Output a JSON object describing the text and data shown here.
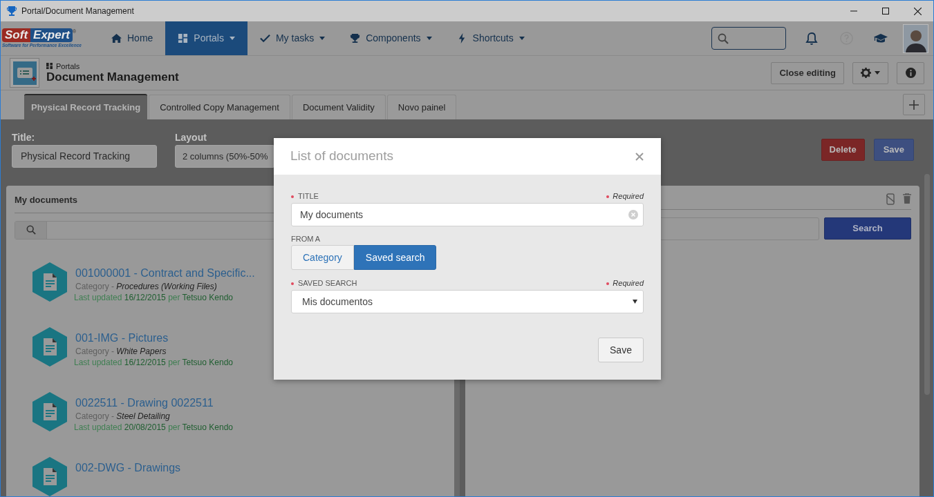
{
  "window": {
    "title": "Portal/Document Management"
  },
  "logo": {
    "part_1": "Soft",
    "part_2": "Expert",
    "mark": "®",
    "tagline": "Software for Performance Excellence"
  },
  "nav": {
    "items": [
      {
        "label": "Home",
        "kind": "home",
        "selected": false,
        "dropdown": false
      },
      {
        "label": "Portals",
        "kind": "grid",
        "selected": true,
        "dropdown": true
      },
      {
        "label": "My tasks",
        "kind": "check",
        "selected": false,
        "dropdown": true
      },
      {
        "label": "Components",
        "kind": "trophy",
        "selected": false,
        "dropdown": true
      },
      {
        "label": "Shortcuts",
        "kind": "bolt",
        "selected": false,
        "dropdown": true
      }
    ]
  },
  "header": {
    "breadcrumb": "Portals",
    "title": "Document Management",
    "close_button": "Close editing"
  },
  "tabs": [
    {
      "label": "Physical Record Tracking",
      "selected": true
    },
    {
      "label": "Controlled Copy Management",
      "selected": false
    },
    {
      "label": "Document Validity",
      "selected": false
    },
    {
      "label": "Novo painel",
      "selected": false
    }
  ],
  "editor": {
    "title_label": "Title:",
    "title_value": "Physical Record Tracking",
    "layout_label": "Layout",
    "layout_value": "2 columns (50%-50%",
    "delete_button": "Delete",
    "save_button": "Save"
  },
  "left_panel": {
    "title": "My documents",
    "items": [
      {
        "title": "001000001 - Contract and Specific...",
        "category_label": "Category -",
        "category": "Procedures (Working Files)",
        "updated_label": "Last updated",
        "date": "16/12/2015",
        "per": "per",
        "author": "Tetsuo Kendo"
      },
      {
        "title": "001-IMG - Pictures",
        "category_label": "Category -",
        "category": "White Papers",
        "updated_label": "Last updated",
        "date": "16/12/2015",
        "per": "per",
        "author": "Tetsuo Kendo"
      },
      {
        "title": "0022511 - Drawing 0022511",
        "category_label": "Category -",
        "category": "Steel Detailing",
        "updated_label": "Last updated",
        "date": "20/08/2015",
        "per": "per",
        "author": "Tetsuo Kendo"
      },
      {
        "title": "002-DWG - Drawings"
      }
    ]
  },
  "right_panel": {
    "search_button": "Search"
  },
  "modal": {
    "title": "List of documents",
    "title_label": "TITLE",
    "title_required": "Required",
    "title_value": "My documents",
    "from_label": "FROM A",
    "options": [
      {
        "label": "Category",
        "selected": false
      },
      {
        "label": "Saved search",
        "selected": true
      }
    ],
    "saved_search_label": "SAVED SEARCH",
    "saved_search_required": "Required",
    "saved_search_value": "Mis documentos",
    "save_button": "Save"
  }
}
